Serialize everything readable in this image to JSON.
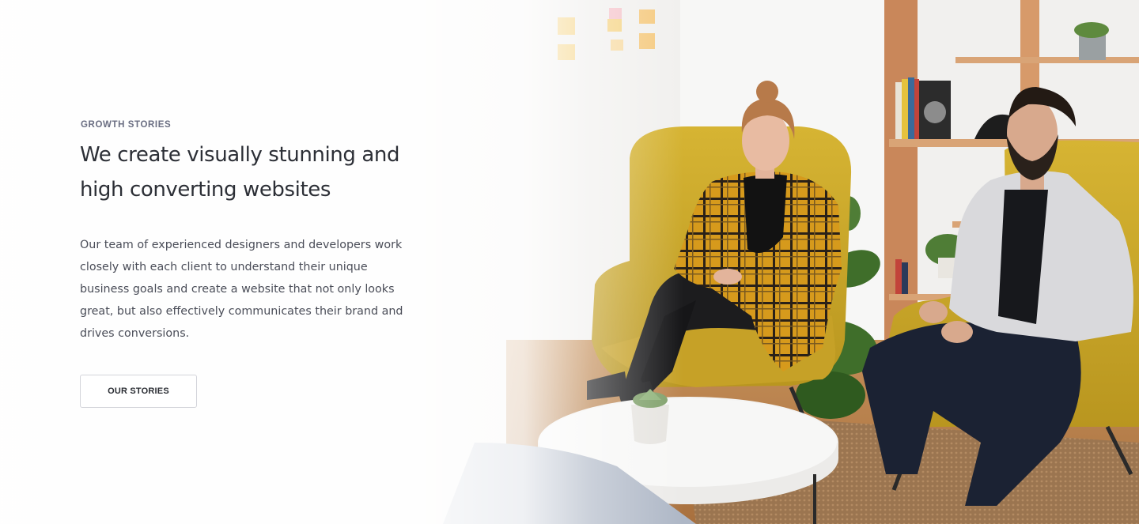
{
  "hero": {
    "eyebrow": "GROWTH STORIES",
    "headline": "We create visually stunning and high converting websites",
    "body": "Our team of experienced designers and developers work closely with each client to understand their unique business goals and create a website that not only looks great, but also effectively communicates their brand and drives conversions.",
    "cta_label": "OUR STORIES"
  },
  "colors": {
    "eyebrow": "#6a6e82",
    "headline": "#2c2f36",
    "body": "#4a4d58",
    "button_border": "#d3d4da",
    "chair_yellow": "#c9a92a",
    "wall": "#f3f2f0",
    "shelf_wood": "#c9875a"
  }
}
